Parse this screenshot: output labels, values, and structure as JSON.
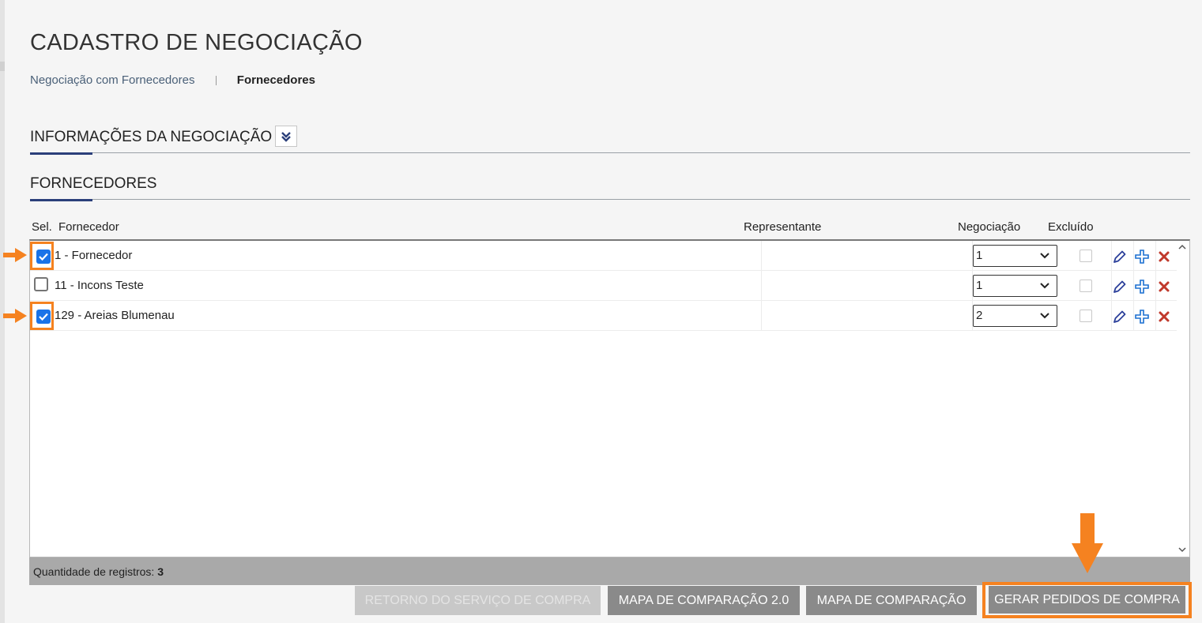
{
  "page": {
    "title": "CADASTRO DE NEGOCIAÇÃO",
    "breadcrumb": {
      "link": "Negociação com Fornecedores",
      "current": "Fornecedores"
    }
  },
  "sections": {
    "info": {
      "title": "INFORMAÇÕES DA NEGOCIAÇÃO",
      "collapse_icon": "double-chevron-down-icon"
    },
    "suppliers": {
      "title": "FORNECEDORES"
    }
  },
  "table": {
    "headers": {
      "sel": "Sel.",
      "supplier": "Fornecedor",
      "representative": "Representante",
      "negotiation": "Negociação",
      "excluded": "Excluído"
    },
    "rows": [
      {
        "selected": true,
        "supplier": "1 - Fornecedor",
        "representative": "",
        "negotiation": "1",
        "excluded": false
      },
      {
        "selected": false,
        "supplier": "11 - Incons Teste",
        "representative": "",
        "negotiation": "1",
        "excluded": false
      },
      {
        "selected": true,
        "supplier": "129 - Areias Blumenau",
        "representative": "",
        "negotiation": "2",
        "excluded": false
      }
    ],
    "row_actions": [
      "pencil-icon",
      "plus-icon",
      "close-icon"
    ],
    "footer": {
      "label": "Quantidade de registros:",
      "count": "3"
    }
  },
  "buttons": {
    "retorno": "RETORNO DO SERVIÇO DE COMPRA",
    "mapa2": "MAPA DE COMPARAÇÃO 2.0",
    "mapa": "MAPA DE COMPARAÇÃO",
    "gerar": "GERAR PEDIDOS DE COMPRA"
  },
  "colors": {
    "accent": "#2b3f7a",
    "highlight": "#f58220",
    "checkbox": "#1a73e8",
    "button": "#8a8a8a"
  }
}
